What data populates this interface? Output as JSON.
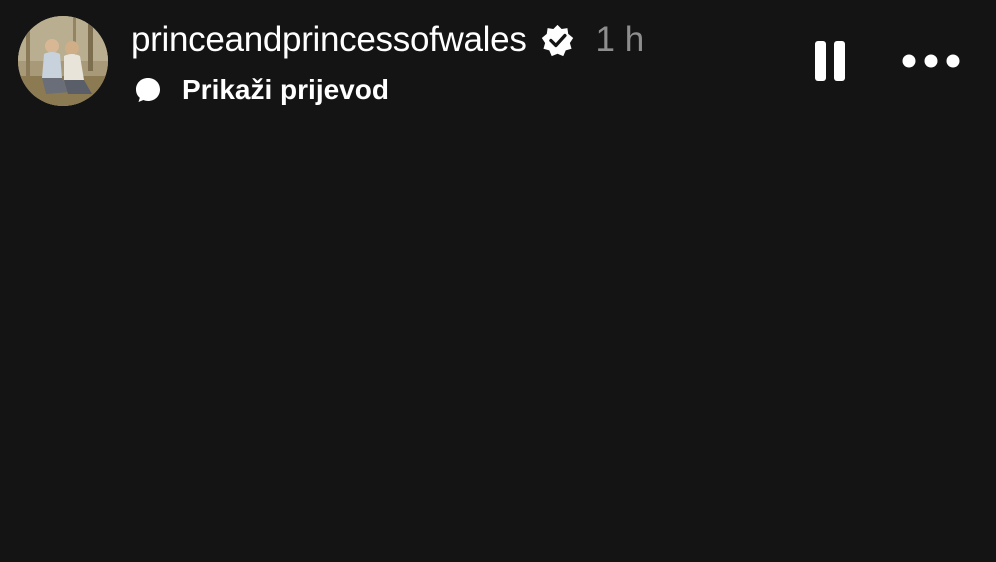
{
  "story": {
    "username": "princeandprincessofwales",
    "verified": true,
    "time": "1 h",
    "translate_label": "Prikaži prijevod"
  },
  "icons": {
    "avatar": "profile-avatar",
    "verified": "verified-badge-icon",
    "translate": "speech-bubble-icon",
    "pause": "pause-icon",
    "more": "more-options-icon"
  },
  "colors": {
    "background": "#141414",
    "text_primary": "#ffffff",
    "text_secondary": "#8e8e8e"
  }
}
